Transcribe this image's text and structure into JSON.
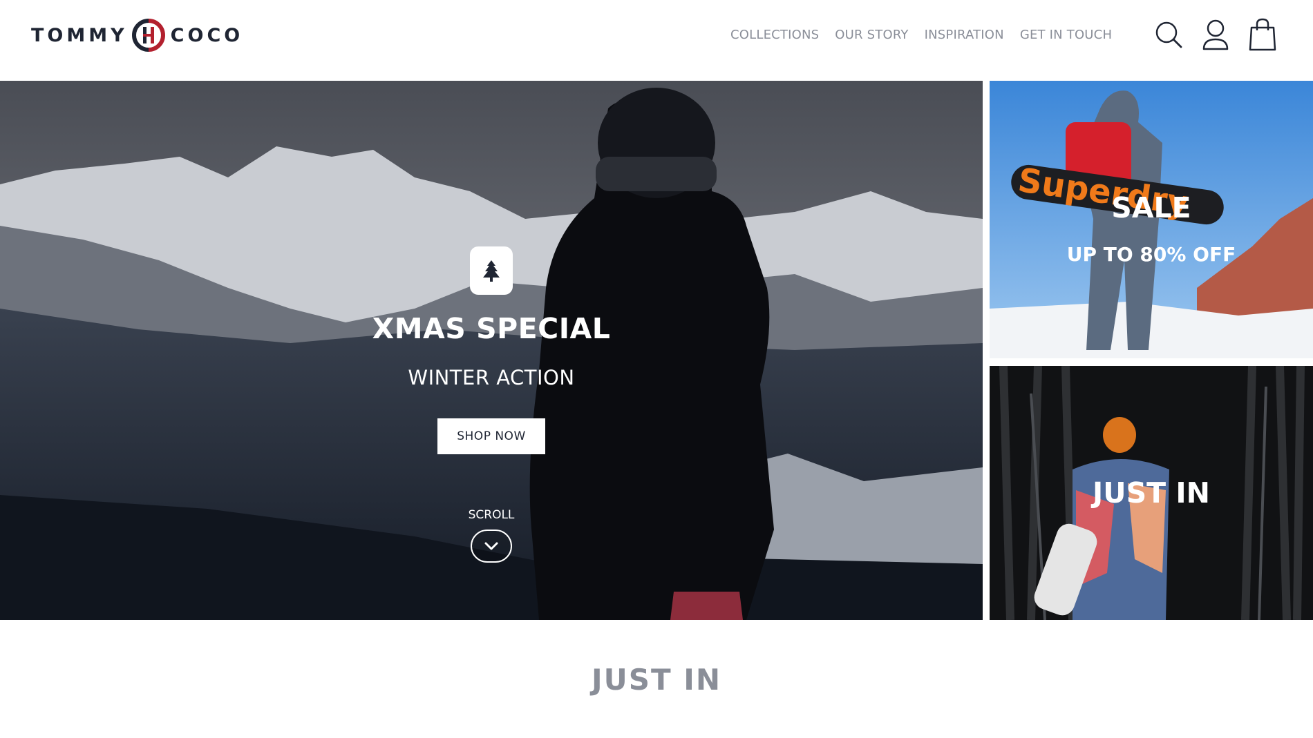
{
  "brand": {
    "word_left": "TOMMY",
    "word_right": "COCO",
    "mark_color_dark": "#1f2533",
    "mark_color_accent": "#b3202e"
  },
  "nav": {
    "items": [
      {
        "label": "COLLECTIONS"
      },
      {
        "label": "OUR STORY"
      },
      {
        "label": "INSPIRATION"
      },
      {
        "label": "GET IN TOUCH"
      }
    ]
  },
  "header_icons": [
    "search-icon",
    "account-icon",
    "shopping-bag-icon"
  ],
  "hero": {
    "badge_icon": "tree-icon",
    "title": "XMAS SPECIAL",
    "subtitle": "WINTER ACTION",
    "cta_label": "SHOP NOW",
    "scroll_label": "SCROLL",
    "scroll_icon": "chevron-down-icon"
  },
  "tiles": {
    "sale": {
      "title": "SALE",
      "subtitle": "UP TO 80% OFF"
    },
    "just_in": {
      "title": "JUST IN"
    }
  },
  "section": {
    "title": "JUST IN"
  },
  "colors": {
    "text_dark": "#1f2533",
    "nav_gray": "#8a8e98",
    "accent_red": "#b3202e"
  }
}
